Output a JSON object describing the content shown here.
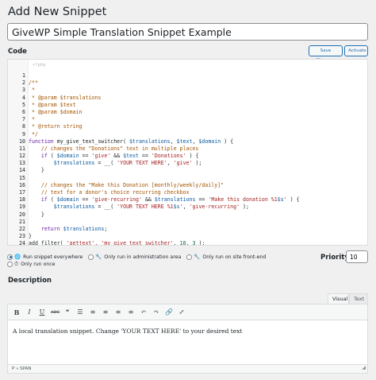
{
  "page": {
    "title": "Add New Snippet"
  },
  "snippet": {
    "name": "GiveWP Simple Translation Snippet Example"
  },
  "code_section": {
    "heading": "Code",
    "save_label": "Save Changes",
    "activate_label": "Activate",
    "placeholder": "<?php",
    "lines": [
      {
        "n": "1",
        "t": ""
      },
      {
        "n": "2",
        "t": "/**"
      },
      {
        "n": "3",
        "t": " *"
      },
      {
        "n": "4",
        "t": " * @param $translations"
      },
      {
        "n": "5",
        "t": " * @param $text"
      },
      {
        "n": "6",
        "t": " * @param $domain"
      },
      {
        "n": "7",
        "t": " *"
      },
      {
        "n": "8",
        "t": " * @return string"
      },
      {
        "n": "9",
        "t": " */"
      },
      {
        "n": "10",
        "t": "function my_give_text_switcher( $translations, $text, $domain ) {"
      },
      {
        "n": "11",
        "t": "    // changes the \"Donations\" text in multiple places"
      },
      {
        "n": "12",
        "t": "    if ( $domain == 'give' && $text == 'Donations' ) {"
      },
      {
        "n": "13",
        "t": "        $translations = __( 'YOUR TEXT HERE', 'give' );"
      },
      {
        "n": "14",
        "t": "    }"
      },
      {
        "n": "15",
        "t": ""
      },
      {
        "n": "16",
        "t": "    // changes the \"Make this Donation [monthly/weekly/daily]\""
      },
      {
        "n": "17",
        "t": "    // text for a donor's choice recurring checkbox"
      },
      {
        "n": "18",
        "t": "    if ( $domain == 'give-recurring' && $translations == 'Make this donation %1$s' ) {"
      },
      {
        "n": "19",
        "t": "        $translations = __( 'YOUR TEXT HERE %1$s', 'give-recurring' );"
      },
      {
        "n": "20",
        "t": "    }"
      },
      {
        "n": "21",
        "t": ""
      },
      {
        "n": "22",
        "t": "    return $translations;"
      },
      {
        "n": "23",
        "t": "}"
      },
      {
        "n": "24",
        "t": "add_filter( 'gettext', 'my_give_text_switcher', 10, 3 );"
      }
    ]
  },
  "scope": {
    "options": [
      {
        "label": "Run snippet everywhere",
        "icon": "globe-icon",
        "checked": true
      },
      {
        "label": "Only run in administration area",
        "icon": "wrench-icon",
        "checked": false
      },
      {
        "label": "Only run on site front-end",
        "icon": "wrench-icon",
        "checked": false
      },
      {
        "label": "Only run once",
        "icon": "clock-icon",
        "checked": false
      }
    ],
    "priority_label": "Priority",
    "priority_value": "10"
  },
  "description": {
    "heading": "Description",
    "tabs": [
      "Visual",
      "Text"
    ],
    "active_tab": "Visual",
    "toolbar": [
      {
        "name": "bold-icon",
        "glyph": "B"
      },
      {
        "name": "italic-icon",
        "glyph": "I"
      },
      {
        "name": "underline-icon",
        "glyph": "U"
      },
      {
        "name": "strikethrough-icon",
        "glyph": "ABC"
      },
      {
        "name": "blockquote-icon",
        "glyph": "❝"
      },
      {
        "name": "bullet-list-icon",
        "glyph": "☰"
      },
      {
        "name": "numbered-list-icon",
        "glyph": "≡"
      },
      {
        "name": "align-left-icon",
        "glyph": "≡"
      },
      {
        "name": "align-center-icon",
        "glyph": "≡"
      },
      {
        "name": "align-right-icon",
        "glyph": "≡"
      },
      {
        "name": "undo-icon",
        "glyph": "↶"
      },
      {
        "name": "redo-icon",
        "glyph": "↷"
      },
      {
        "name": "link-icon",
        "glyph": "🔗"
      },
      {
        "name": "fullscreen-icon",
        "glyph": "⤢"
      }
    ],
    "content": "A local translation snippet. Change 'YOUR TEXT HERE' to your desired text",
    "status_path": "P » SPAN"
  }
}
